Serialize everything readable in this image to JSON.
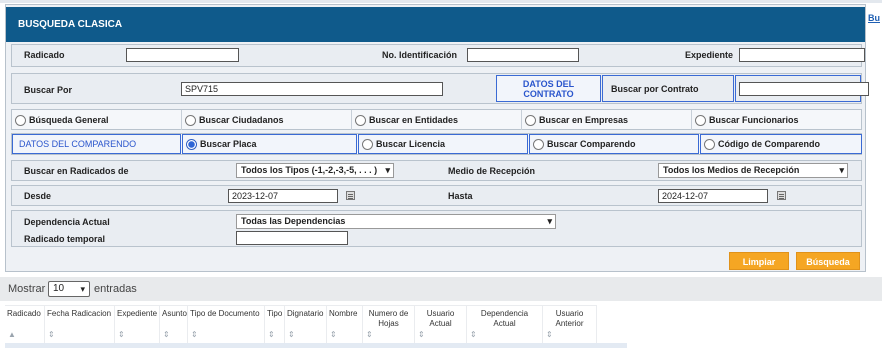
{
  "side_link": "Bu",
  "header": {
    "title": "BUSQUEDA CLASICA"
  },
  "row1": {
    "radicado_label": "Radicado",
    "radicado_value": "",
    "identificacion_label": "No. Identificación",
    "identificacion_value": "",
    "expediente_label": "Expediente",
    "expediente_value": ""
  },
  "row2": {
    "buscar_por_label": "Buscar Por",
    "buscar_por_value": "SPV715",
    "datos_contrato_label": "DATOS DEL CONTRATO",
    "buscar_contrato_label": "Buscar por Contrato",
    "buscar_contrato_value": ""
  },
  "row3": {
    "options": [
      "Búsqueda General",
      "Buscar Ciudadanos",
      "Buscar en Entidades",
      "Buscar en Empresas",
      "Buscar Funcionarios"
    ]
  },
  "row4": {
    "section_label": "DATOS DEL COMPARENDO",
    "options": [
      "Buscar Placa",
      "Buscar Licencia",
      "Buscar Comparendo",
      "Código de Comparendo"
    ],
    "selected": "Buscar Placa"
  },
  "row5": {
    "radicados_label": "Buscar en Radicados de",
    "radicados_value": "Todos los Tipos (-1,-2,-3,-5, . . . )",
    "medio_label": "Medio de Recepción",
    "medio_value": "Todos los Medios de Recepción"
  },
  "row6": {
    "desde_label": "Desde",
    "desde_value": "2023-12-07",
    "hasta_label": "Hasta",
    "hasta_value": "2024-12-07"
  },
  "row7": {
    "dependencia_label": "Dependencia Actual",
    "dependencia_value": "Todas las Dependencias",
    "temporal_label": "Radicado temporal",
    "temporal_value": ""
  },
  "buttons": {
    "limpiar": "Limpiar",
    "busqueda": "Búsqueda"
  },
  "table": {
    "show_label": "Mostrar",
    "entries_value": "10",
    "entries_label": "entradas",
    "columns": [
      "Radicado",
      "Fecha Radicacion",
      "Expediente",
      "Asunto",
      "Tipo de Documento",
      "Tipo",
      "Dignatario",
      "Nombre",
      "Numero de Hojas",
      "Usuario Actual",
      "Dependencia Actual",
      "Usuario Anterior"
    ]
  },
  "colors": {
    "header": "#0f5a8b",
    "button": "#f5a623",
    "accent_blue": "#2a55cc"
  },
  "icons": {
    "calendar": "calendar-icon",
    "dropdown": "chevron-down-icon",
    "sort": "sort-icon"
  }
}
